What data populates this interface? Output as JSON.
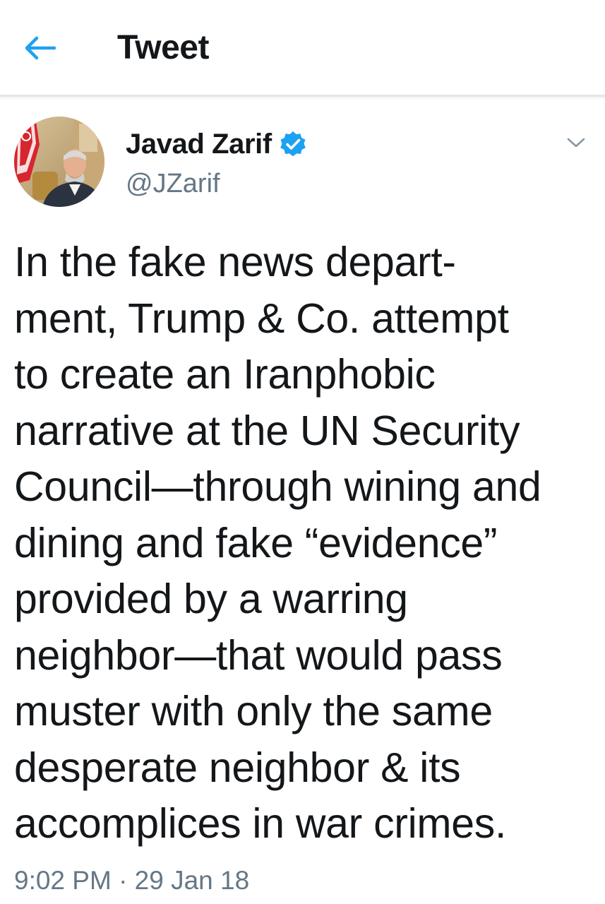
{
  "header": {
    "back_icon": "arrow-left-icon",
    "title": "Tweet",
    "accent_color": "#1da1f2"
  },
  "author": {
    "name": "Javad Zarif",
    "handle": "@JZarif",
    "verified": true,
    "verified_icon": "verified-badge-icon",
    "menu_icon": "chevron-down-icon"
  },
  "tweet": {
    "lines": [
      "In the fake news depart-",
      "ment, Trump & Co. attempt",
      "to create an Iranphobic",
      "narrative at the UN Security",
      "Council—through wining and",
      "dining and fake “evidence”",
      "provided by a warring",
      "neighbor—that would pass",
      "muster with only the same",
      "desperate neighbor & its",
      "accomplices in war crimes."
    ],
    "timestamp": "9:02 PM · 29 Jan 18"
  }
}
